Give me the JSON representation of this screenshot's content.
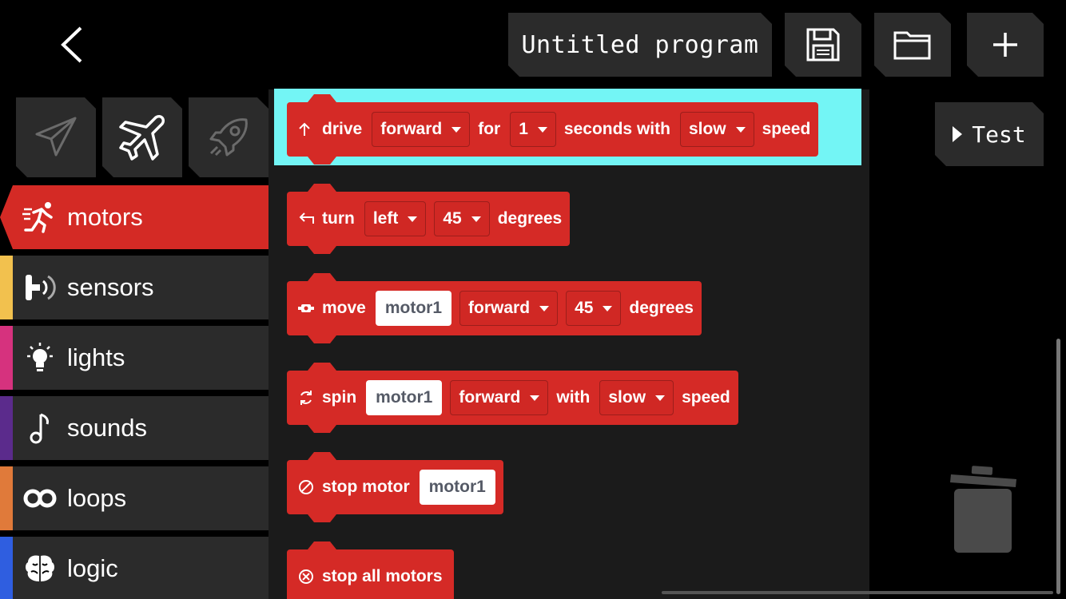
{
  "header": {
    "program_title": "Untitled program"
  },
  "toolbar": {
    "test_label": "Test"
  },
  "robot_tabs": [
    {
      "icon": "paper-plane-icon"
    },
    {
      "icon": "airplane-icon"
    },
    {
      "icon": "rocket-icon"
    }
  ],
  "categories": [
    {
      "label": "motors",
      "color": "#d42a25",
      "icon": "running-person-icon",
      "active": true
    },
    {
      "label": "sensors",
      "color": "#f2c14e",
      "icon": "sensor-icon"
    },
    {
      "label": "lights",
      "color": "#d6327e",
      "icon": "light-bulb-icon"
    },
    {
      "label": "sounds",
      "color": "#5b2b8c",
      "icon": "music-note-icon"
    },
    {
      "label": "loops",
      "color": "#e07a3a",
      "icon": "loop-icon"
    },
    {
      "label": "logic",
      "color": "#2f5ee0",
      "icon": "brain-icon"
    }
  ],
  "blocks": {
    "drive": {
      "verb": "drive",
      "direction": "forward",
      "for": "for",
      "duration": "1",
      "seconds_with": "seconds with",
      "speed": "slow",
      "speed_word": "speed"
    },
    "turn": {
      "verb": "turn",
      "direction": "left",
      "degrees": "45",
      "degrees_word": "degrees"
    },
    "move": {
      "verb": "move",
      "motor": "motor1",
      "direction": "forward",
      "degrees": "45",
      "degrees_word": "degrees"
    },
    "spin": {
      "verb": "spin",
      "motor": "motor1",
      "direction": "forward",
      "with": "with",
      "speed": "slow",
      "speed_word": "speed"
    },
    "stop_motor": {
      "verb": "stop motor",
      "motor": "motor1"
    },
    "stop_all": {
      "verb": "stop all motors"
    }
  },
  "colors": {
    "block_red": "#d52a26",
    "highlight": "#73f5f5",
    "panel": "#2b2b2b"
  }
}
